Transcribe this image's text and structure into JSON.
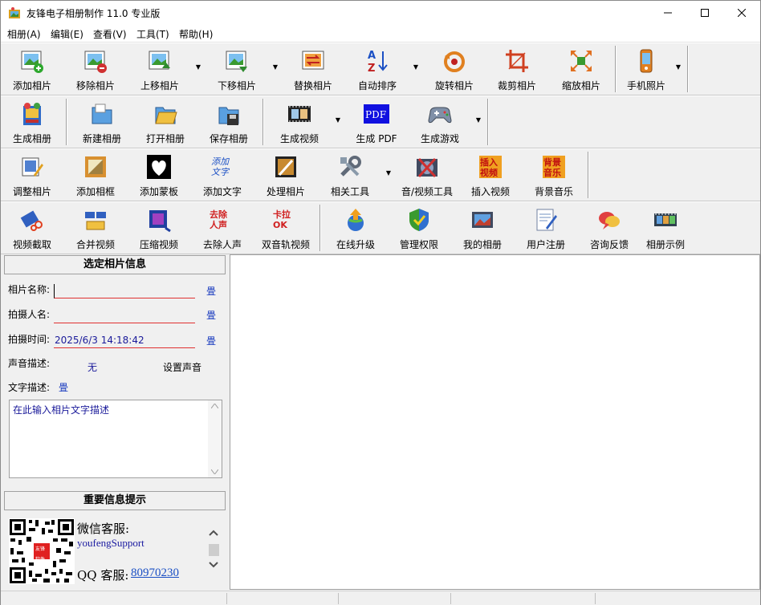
{
  "window": {
    "title": "友锋电子相册制作 11.0 专业版",
    "minimize": "—",
    "maximize": "☐",
    "close": "✕"
  },
  "menu": [
    "相册(A)",
    "编辑(E)",
    "查看(V)",
    "工具(T)",
    "帮助(H)"
  ],
  "toolbar1": [
    "添加相片",
    "移除相片",
    "上移相片",
    "下移相片",
    "替换相片",
    "自动排序",
    "旋转相片",
    "裁剪相片",
    "缩放相片",
    "手机照片"
  ],
  "toolbar2": [
    "生成相册",
    "新建相册",
    "打开相册",
    "保存相册",
    "生成视频",
    "生成 PDF",
    "生成游戏"
  ],
  "toolbar3": [
    "调整相片",
    "添加相框",
    "添加蒙板",
    "添加文字",
    "处理相片",
    "相关工具",
    "音/视频工具",
    "插入视频",
    "背景音乐"
  ],
  "toolbar4": [
    "视频截取",
    "合并视频",
    "压缩视频",
    "去除人声",
    "双音轨视频",
    "在线升级",
    "管理权限",
    "我的相册",
    "用户注册",
    "咨询反馈",
    "相册示例"
  ],
  "icon_text": {
    "pdf": "PDF",
    "add_text": "添加文字",
    "remove_voice": "去除人声",
    "karaoke": "卡拉OK",
    "insert_video": "插入视频",
    "bg_music": "背景音乐",
    "qr_center": "友锋软件"
  },
  "photo_info": {
    "header": "选定相片信息",
    "name_label": "相片名称:",
    "name_value": "",
    "photographer_label": "拍摄人名:",
    "photographer_value": "",
    "time_label": "拍摄时间:",
    "time_value": "2025/6/3 14:18:42",
    "sound_label": "声音描述:",
    "sound_value": "无",
    "set_sound": "设置声音",
    "text_label": "文字描述:",
    "text_placeholder": "在此输入相片文字描述",
    "edit_glyph": "畳"
  },
  "notice": {
    "header": "重要信息提示",
    "wechat_label": "微信客服:",
    "wechat_id": "youfengSupport",
    "qq_label": "QQ 客服:",
    "qq_number": "80970230"
  },
  "colors": {
    "accent_red": "#e03030",
    "link_blue": "#1a4fc4",
    "value_blue": "#1a1a9a"
  }
}
